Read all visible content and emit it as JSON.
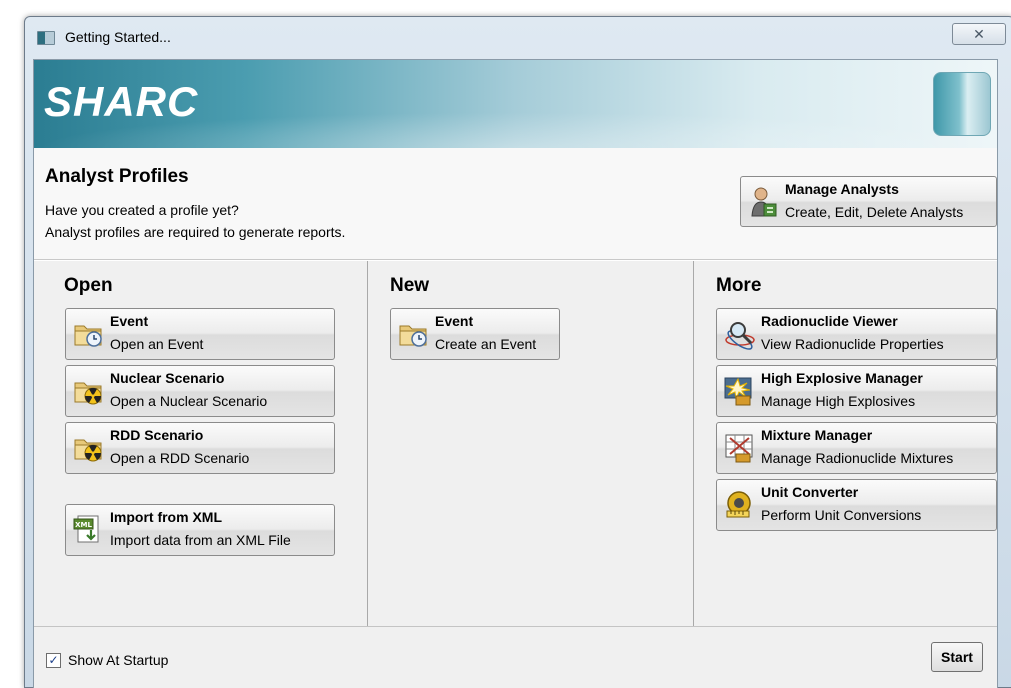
{
  "window": {
    "title": "Getting Started...",
    "close_glyph": "✕"
  },
  "banner": {
    "logo_text": "SHARC"
  },
  "profiles": {
    "heading": "Analyst Profiles",
    "line1": "Have you created a profile yet?",
    "line2": "Analyst profiles are required to generate reports.",
    "manage_button": {
      "title": "Manage Analysts",
      "subtitle": "Create, Edit, Delete Analysts",
      "icon": "analyst-person-icon"
    }
  },
  "open": {
    "heading": "Open",
    "buttons": [
      {
        "title": "Event",
        "subtitle": "Open an Event",
        "icon": "folder-clock-icon"
      },
      {
        "title": "Nuclear Scenario",
        "subtitle": "Open a Nuclear Scenario",
        "icon": "folder-radiation-icon"
      },
      {
        "title": "RDD Scenario",
        "subtitle": "Open a RDD Scenario",
        "icon": "folder-radiation-icon"
      },
      {
        "title": "Import from XML",
        "subtitle": "Import data from an XML File",
        "icon": "xml-import-icon",
        "icon_text": "XML"
      }
    ]
  },
  "new": {
    "heading": "New",
    "buttons": [
      {
        "title": "Event",
        "subtitle": "Create an Event",
        "icon": "folder-clock-icon"
      }
    ]
  },
  "more": {
    "heading": "More",
    "buttons": [
      {
        "title": "Radionuclide Viewer",
        "subtitle": "View Radionuclide Properties",
        "icon": "magnifier-atom-icon"
      },
      {
        "title": "High Explosive Manager",
        "subtitle": "Manage High Explosives",
        "icon": "explosion-icon"
      },
      {
        "title": "Mixture Manager",
        "subtitle": "Manage Radionuclide Mixtures",
        "icon": "mixture-grid-icon"
      },
      {
        "title": "Unit Converter",
        "subtitle": "Perform Unit Conversions",
        "icon": "tape-measure-icon"
      }
    ]
  },
  "footer": {
    "show_at_startup_label": "Show At Startup",
    "show_at_startup_checked": true,
    "check_glyph": "✓",
    "start_label": "Start"
  },
  "colors": {
    "banner_dark": "#2b7d92",
    "banner_light": "#eef6f8",
    "panel_bg": "#f0f0f0"
  }
}
